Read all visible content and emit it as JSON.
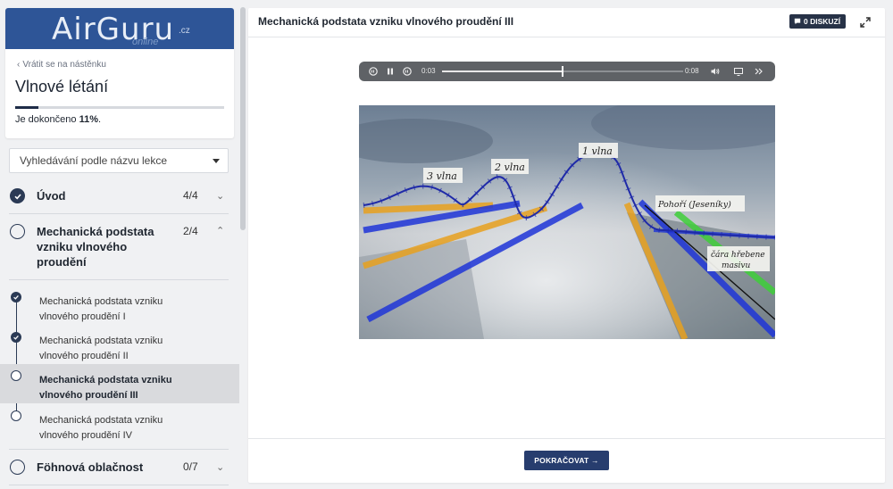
{
  "brand": {
    "name": "AirGuru",
    "tld": ".cz",
    "sub": "online",
    "color": "#2e5597"
  },
  "sidebar": {
    "back_link": "Vrátit se na nástěnku",
    "course_title": "Vlnové létání",
    "progress": {
      "prefix": "Je dokončeno ",
      "value": "11%",
      "suffix": ".",
      "fraction": 0.11
    },
    "search_placeholder": "Vyhledávání podle názvu lekce",
    "sections": [
      {
        "title": "Úvod",
        "count": "4/4",
        "completed": true,
        "expanded": false
      },
      {
        "title": "Mechanická podstata vzniku vlnového proudění",
        "count": "2/4",
        "completed": false,
        "expanded": true
      },
      {
        "title": "Föhnová oblačnost",
        "count": "0/7",
        "completed": false,
        "expanded": false
      }
    ],
    "lessons": [
      {
        "title": "Mechanická podstata vzniku vlnového proudění I",
        "completed": true,
        "active": false
      },
      {
        "title": "Mechanická podstata vzniku vlnového proudění II",
        "completed": true,
        "active": false
      },
      {
        "title": "Mechanická podstata vzniku vlnového proudění III",
        "completed": false,
        "active": true
      },
      {
        "title": "Mechanická podstata vzniku vlnového proudění IV",
        "completed": false,
        "active": false
      }
    ]
  },
  "main": {
    "lesson_title": "Mechanická podstata vzniku vlnového proudění III",
    "discussion_label": "0 DISKUZÍ",
    "continue_label": "POKRAČOVAT →"
  },
  "player": {
    "current_time": "0:03",
    "duration": "0:08",
    "progress": 0.5
  },
  "video_annotations": {
    "wave3": "3 vlna",
    "wave2": "2 vlna",
    "wave1": "1 vlna",
    "mountains": "Pohoří (Jeseníky)",
    "ridge_line_1": "čára hřebene",
    "ridge_line_2": "masivu"
  },
  "colors": {
    "accent": "#273d6e",
    "dark_button": "#273247",
    "progress_fill": "#1f2d48"
  }
}
